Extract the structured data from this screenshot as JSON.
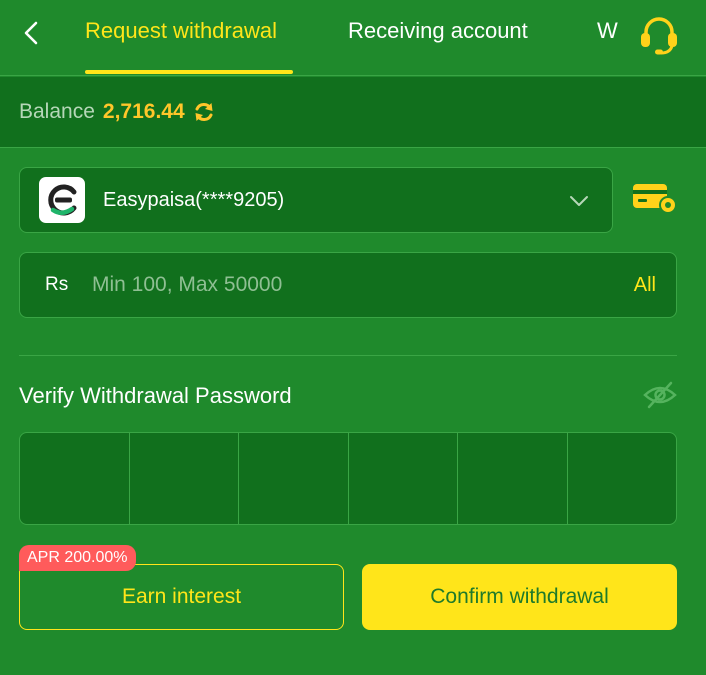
{
  "header": {
    "tabs": [
      {
        "label": "Request withdrawal",
        "active": true
      },
      {
        "label": "Receiving account",
        "active": false
      },
      {
        "label": "W",
        "active": false
      }
    ]
  },
  "balance": {
    "label": "Balance",
    "value": "2,716.44"
  },
  "account": {
    "name": "Easypaisa(****9205)",
    "logo_letter": "e"
  },
  "amount": {
    "currency": "Rs",
    "placeholder": "Min 100, Max 50000",
    "value": "",
    "all_label": "All"
  },
  "password": {
    "label": "Verify Withdrawal Password",
    "digits": 6
  },
  "actions": {
    "apr_badge": "APR 200.00%",
    "earn_label": "Earn interest",
    "confirm_label": "Confirm withdrawal"
  },
  "colors": {
    "background": "#1f8a2c",
    "panel": "#11701d",
    "accent_yellow": "#ffe51a",
    "balance_orange": "#ffc62a",
    "badge_red": "#ff5b5b"
  },
  "icons": {
    "back": "chevron-left-icon",
    "support": "headset-icon",
    "refresh": "refresh-icon",
    "account_dropdown": "chevron-down-icon",
    "card_settings": "card-gear-icon",
    "password_visibility": "eye-off-icon"
  }
}
